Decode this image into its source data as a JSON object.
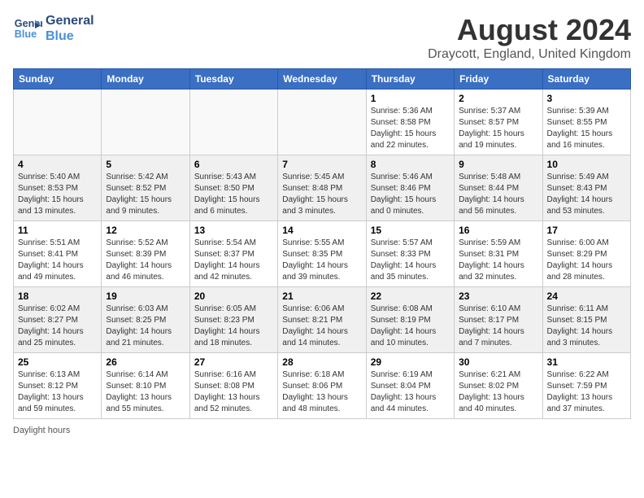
{
  "header": {
    "logo_line1": "General",
    "logo_line2": "Blue",
    "main_title": "August 2024",
    "subtitle": "Draycott, England, United Kingdom"
  },
  "days_of_week": [
    "Sunday",
    "Monday",
    "Tuesday",
    "Wednesday",
    "Thursday",
    "Friday",
    "Saturday"
  ],
  "weeks": [
    [
      {
        "day": "",
        "info": ""
      },
      {
        "day": "",
        "info": ""
      },
      {
        "day": "",
        "info": ""
      },
      {
        "day": "",
        "info": ""
      },
      {
        "day": "1",
        "info": "Sunrise: 5:36 AM\nSunset: 8:58 PM\nDaylight: 15 hours\nand 22 minutes."
      },
      {
        "day": "2",
        "info": "Sunrise: 5:37 AM\nSunset: 8:57 PM\nDaylight: 15 hours\nand 19 minutes."
      },
      {
        "day": "3",
        "info": "Sunrise: 5:39 AM\nSunset: 8:55 PM\nDaylight: 15 hours\nand 16 minutes."
      }
    ],
    [
      {
        "day": "4",
        "info": "Sunrise: 5:40 AM\nSunset: 8:53 PM\nDaylight: 15 hours\nand 13 minutes."
      },
      {
        "day": "5",
        "info": "Sunrise: 5:42 AM\nSunset: 8:52 PM\nDaylight: 15 hours\nand 9 minutes."
      },
      {
        "day": "6",
        "info": "Sunrise: 5:43 AM\nSunset: 8:50 PM\nDaylight: 15 hours\nand 6 minutes."
      },
      {
        "day": "7",
        "info": "Sunrise: 5:45 AM\nSunset: 8:48 PM\nDaylight: 15 hours\nand 3 minutes."
      },
      {
        "day": "8",
        "info": "Sunrise: 5:46 AM\nSunset: 8:46 PM\nDaylight: 15 hours\nand 0 minutes."
      },
      {
        "day": "9",
        "info": "Sunrise: 5:48 AM\nSunset: 8:44 PM\nDaylight: 14 hours\nand 56 minutes."
      },
      {
        "day": "10",
        "info": "Sunrise: 5:49 AM\nSunset: 8:43 PM\nDaylight: 14 hours\nand 53 minutes."
      }
    ],
    [
      {
        "day": "11",
        "info": "Sunrise: 5:51 AM\nSunset: 8:41 PM\nDaylight: 14 hours\nand 49 minutes."
      },
      {
        "day": "12",
        "info": "Sunrise: 5:52 AM\nSunset: 8:39 PM\nDaylight: 14 hours\nand 46 minutes."
      },
      {
        "day": "13",
        "info": "Sunrise: 5:54 AM\nSunset: 8:37 PM\nDaylight: 14 hours\nand 42 minutes."
      },
      {
        "day": "14",
        "info": "Sunrise: 5:55 AM\nSunset: 8:35 PM\nDaylight: 14 hours\nand 39 minutes."
      },
      {
        "day": "15",
        "info": "Sunrise: 5:57 AM\nSunset: 8:33 PM\nDaylight: 14 hours\nand 35 minutes."
      },
      {
        "day": "16",
        "info": "Sunrise: 5:59 AM\nSunset: 8:31 PM\nDaylight: 14 hours\nand 32 minutes."
      },
      {
        "day": "17",
        "info": "Sunrise: 6:00 AM\nSunset: 8:29 PM\nDaylight: 14 hours\nand 28 minutes."
      }
    ],
    [
      {
        "day": "18",
        "info": "Sunrise: 6:02 AM\nSunset: 8:27 PM\nDaylight: 14 hours\nand 25 minutes."
      },
      {
        "day": "19",
        "info": "Sunrise: 6:03 AM\nSunset: 8:25 PM\nDaylight: 14 hours\nand 21 minutes."
      },
      {
        "day": "20",
        "info": "Sunrise: 6:05 AM\nSunset: 8:23 PM\nDaylight: 14 hours\nand 18 minutes."
      },
      {
        "day": "21",
        "info": "Sunrise: 6:06 AM\nSunset: 8:21 PM\nDaylight: 14 hours\nand 14 minutes."
      },
      {
        "day": "22",
        "info": "Sunrise: 6:08 AM\nSunset: 8:19 PM\nDaylight: 14 hours\nand 10 minutes."
      },
      {
        "day": "23",
        "info": "Sunrise: 6:10 AM\nSunset: 8:17 PM\nDaylight: 14 hours\nand 7 minutes."
      },
      {
        "day": "24",
        "info": "Sunrise: 6:11 AM\nSunset: 8:15 PM\nDaylight: 14 hours\nand 3 minutes."
      }
    ],
    [
      {
        "day": "25",
        "info": "Sunrise: 6:13 AM\nSunset: 8:12 PM\nDaylight: 13 hours\nand 59 minutes."
      },
      {
        "day": "26",
        "info": "Sunrise: 6:14 AM\nSunset: 8:10 PM\nDaylight: 13 hours\nand 55 minutes."
      },
      {
        "day": "27",
        "info": "Sunrise: 6:16 AM\nSunset: 8:08 PM\nDaylight: 13 hours\nand 52 minutes."
      },
      {
        "day": "28",
        "info": "Sunrise: 6:18 AM\nSunset: 8:06 PM\nDaylight: 13 hours\nand 48 minutes."
      },
      {
        "day": "29",
        "info": "Sunrise: 6:19 AM\nSunset: 8:04 PM\nDaylight: 13 hours\nand 44 minutes."
      },
      {
        "day": "30",
        "info": "Sunrise: 6:21 AM\nSunset: 8:02 PM\nDaylight: 13 hours\nand 40 minutes."
      },
      {
        "day": "31",
        "info": "Sunrise: 6:22 AM\nSunset: 7:59 PM\nDaylight: 13 hours\nand 37 minutes."
      }
    ]
  ],
  "footer": {
    "daylight_label": "Daylight hours"
  }
}
